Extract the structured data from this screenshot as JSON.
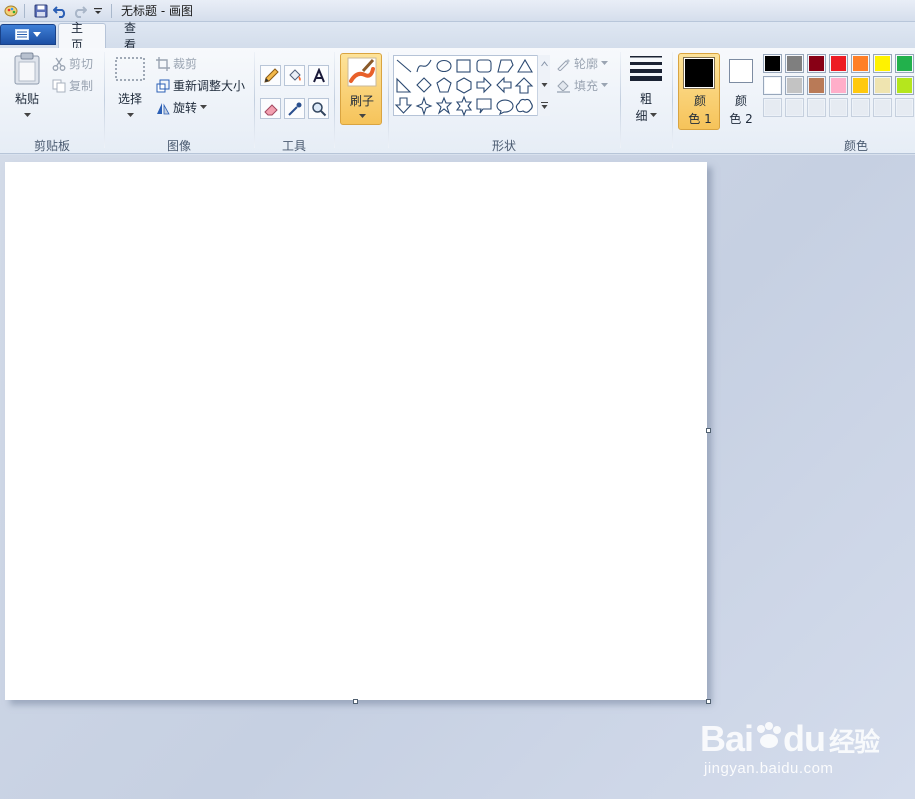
{
  "window": {
    "title": "无标题 - 画图"
  },
  "tabs": [
    {
      "label": "主页",
      "active": true
    },
    {
      "label": "查看",
      "active": false
    }
  ],
  "ribbon": {
    "clipboard": {
      "group_label": "剪贴板",
      "paste_label": "粘贴",
      "cut_label": "剪切",
      "copy_label": "复制"
    },
    "image": {
      "group_label": "图像",
      "select_label": "选择",
      "crop_label": "裁剪",
      "resize_label": "重新调整大小",
      "rotate_label": "旋转"
    },
    "tools": {
      "group_label": "工具",
      "items": [
        "pencil-icon",
        "fill-bucket-icon",
        "text-icon",
        "eraser-icon",
        "color-picker-icon",
        "magnifier-icon"
      ]
    },
    "brushes": {
      "label": "刷子"
    },
    "shapes": {
      "group_label": "形状",
      "outline_label": "轮廓",
      "fill_label": "填充",
      "items": [
        "line",
        "curve",
        "oval",
        "rectangle",
        "rounded-rectangle",
        "polygon",
        "triangle",
        "right-triangle",
        "diamond",
        "pentagon",
        "hexagon",
        "right-arrow",
        "left-arrow",
        "up-arrow",
        "down-arrow",
        "four-point-star",
        "five-point-star",
        "six-point-star",
        "rounded-callout",
        "oval-callout",
        "cloud-callout"
      ]
    },
    "size": {
      "label_top": "粗",
      "label_bottom": "细"
    },
    "colors": {
      "group_label": "颜色",
      "color1_label_top": "颜",
      "color1_label_bottom": "色 1",
      "color2_label_top": "颜",
      "color2_label_bottom": "色 2",
      "color1": "#000000",
      "color2": "#ffffff",
      "palette_row1": [
        "#000000",
        "#7f7f7f",
        "#880015",
        "#ed1c24",
        "#ff7f27",
        "#fff200",
        "#22b14c"
      ],
      "palette_row2": [
        "#ffffff",
        "#c3c3c3",
        "#b97a57",
        "#ffaec9",
        "#ffc90e",
        "#efe4b0",
        "#b5e61d"
      ],
      "palette_row3": [
        "#e6ebf2",
        "#e6ebf2",
        "#e6ebf2",
        "#e6ebf2",
        "#e6ebf2",
        "#e6ebf2",
        "#e6ebf2"
      ]
    }
  },
  "watermark": {
    "line1_a": "Bai",
    "line1_b": "du",
    "line1_c": "经验",
    "line2": "jingyan.baidu.com"
  }
}
